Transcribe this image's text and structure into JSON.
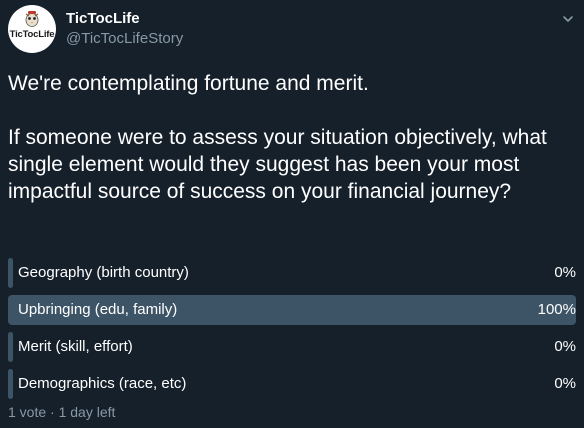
{
  "author": {
    "display_name": "TicTocLife",
    "handle": "@TicTocLifeStory",
    "avatar_text": "TicTocLife"
  },
  "tweet": {
    "line1": "We're contemplating fortune and merit.",
    "line2": "If someone were to assess your situation objectively, what single element would they suggest has been your most impactful source of success on your financial journey?"
  },
  "poll": {
    "options": [
      {
        "label": "Geography (birth country)",
        "percent_text": "0%",
        "percent": 0
      },
      {
        "label": "Upbringing (edu, family)",
        "percent_text": "100%",
        "percent": 100
      },
      {
        "label": "Merit (skill, effort)",
        "percent_text": "0%",
        "percent": 0
      },
      {
        "label": "Demographics (race, etc)",
        "percent_text": "0%",
        "percent": 0
      }
    ],
    "summary": "1 vote · 1 day left"
  },
  "icons": {
    "menu": "chevron-down-icon",
    "avatar": "tictoclife-logo"
  },
  "colors": {
    "background": "#15202b",
    "bar": "#3d5466",
    "secondary_text": "#8899a6"
  }
}
